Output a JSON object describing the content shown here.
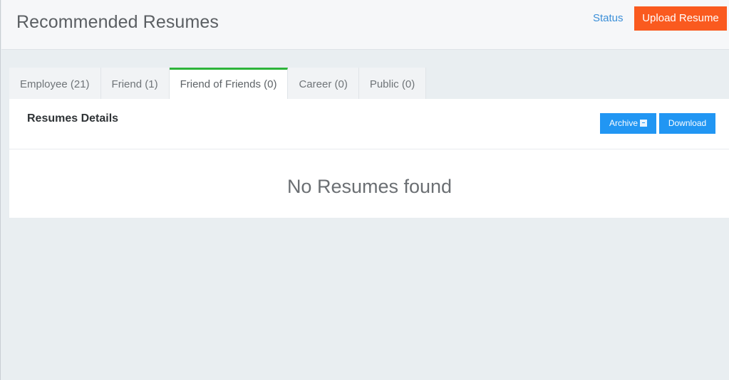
{
  "header": {
    "title": "Recommended Resumes",
    "status_link": "Status",
    "upload_button": "Upload Resume"
  },
  "tabs": [
    {
      "label": "Employee (21)",
      "active": false
    },
    {
      "label": "Friend (1)",
      "active": false
    },
    {
      "label": "Friend of Friends (0)",
      "active": true
    },
    {
      "label": "Career (0)",
      "active": false
    },
    {
      "label": "Public (0)",
      "active": false
    }
  ],
  "panel": {
    "title": "Resumes Details",
    "archive_button": "Archive",
    "download_button": "Download",
    "empty_message": "No Resumes found"
  },
  "colors": {
    "primary": "#2196f3",
    "accent": "#fa5a1f",
    "active_tab": "#2db43a",
    "link": "#3b8fd8"
  },
  "icons": {
    "archive": "archive-icon"
  }
}
